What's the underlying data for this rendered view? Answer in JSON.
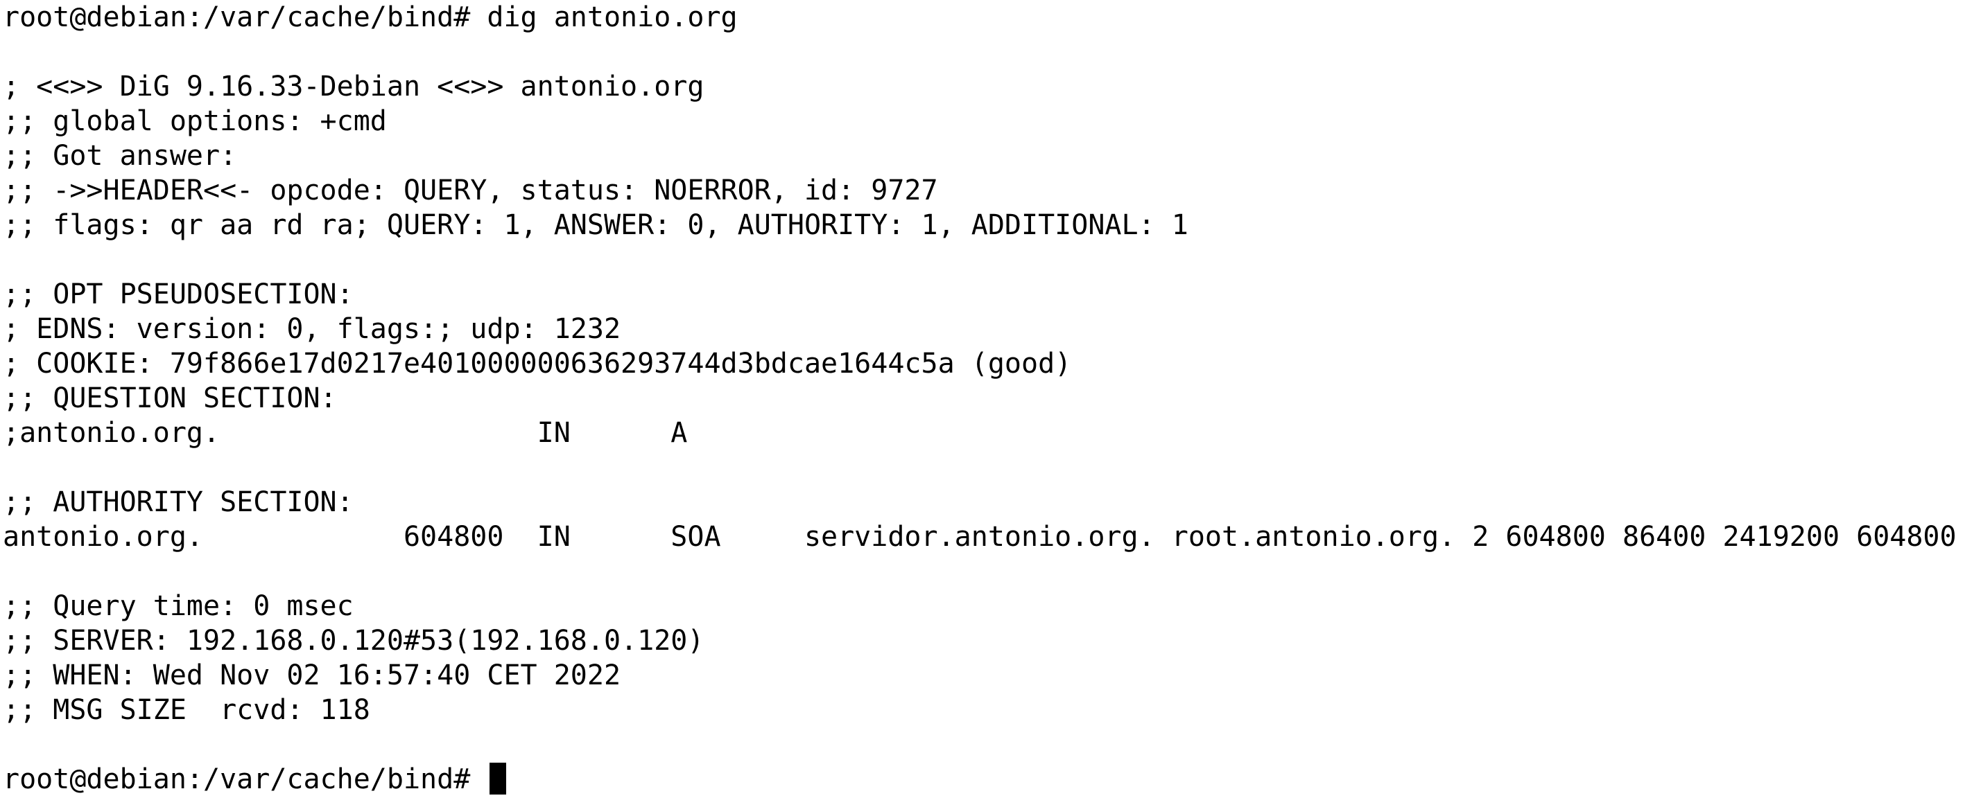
{
  "terminal": {
    "lines": [
      "root@debian:/var/cache/bind# dig antonio.org",
      "",
      "; <<>> DiG 9.16.33-Debian <<>> antonio.org",
      ";; global options: +cmd",
      ";; Got answer:",
      ";; ->>HEADER<<- opcode: QUERY, status: NOERROR, id: 9727",
      ";; flags: qr aa rd ra; QUERY: 1, ANSWER: 0, AUTHORITY: 1, ADDITIONAL: 1",
      "",
      ";; OPT PSEUDOSECTION:",
      "; EDNS: version: 0, flags:; udp: 1232",
      "; COOKIE: 79f866e17d0217e401000000636293744d3bdcae1644c5a (good)",
      ";; QUESTION SECTION:",
      ";antonio.org.                   IN      A",
      "",
      ";; AUTHORITY SECTION:",
      "antonio.org.            604800  IN      SOA     servidor.antonio.org. root.antonio.org. 2 604800 86400 2419200 604800",
      "",
      ";; Query time: 0 msec",
      ";; SERVER: 192.168.0.120#53(192.168.0.120)",
      ";; WHEN: Wed Nov 02 16:57:40 CET 2022",
      ";; MSG SIZE  rcvd: 118",
      ""
    ],
    "prompt": "root@debian:/var/cache/bind# "
  }
}
